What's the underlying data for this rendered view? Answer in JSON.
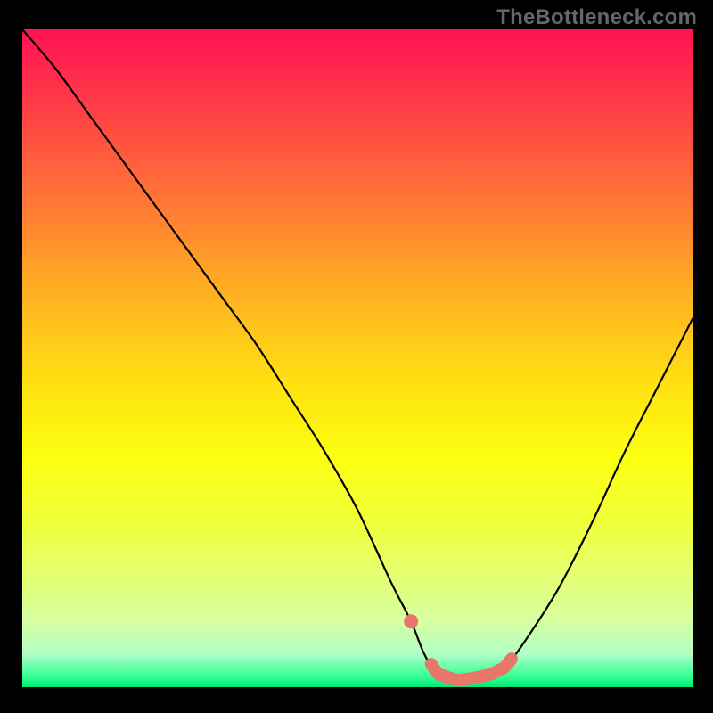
{
  "watermark": "TheBottleneck.com",
  "colors": {
    "highlight": "#e8766b",
    "curve": "#000000",
    "gradient_top": "#ff1450",
    "gradient_bottom": "#00e878"
  },
  "chart_data": {
    "type": "line",
    "title": "",
    "xlabel": "",
    "ylabel": "",
    "xlim": [
      0,
      100
    ],
    "ylim": [
      0,
      100
    ],
    "description": "Bottleneck / mismatch curve. Y represents mismatch percentage (top=100% bad, bottom=0% good) rendered over a vertical heat gradient from red (high) to green (low). A V-shaped curve reaches its minimum trough in the right-center region.",
    "series": [
      {
        "name": "mismatch_curve",
        "x": [
          0,
          5,
          10,
          15,
          20,
          25,
          30,
          35,
          40,
          45,
          50,
          55,
          58,
          60,
          62,
          65,
          68,
          70,
          72,
          75,
          80,
          85,
          90,
          95,
          100
        ],
        "y": [
          100,
          94,
          87,
          80,
          73,
          66,
          59,
          52,
          44,
          36,
          27,
          16,
          10,
          5,
          2,
          1,
          1.5,
          2,
          3,
          7,
          15,
          25,
          36,
          46,
          56
        ]
      }
    ],
    "highlight": {
      "dot_x": 58,
      "segment_x_start": 61,
      "segment_x_end": 73
    }
  }
}
